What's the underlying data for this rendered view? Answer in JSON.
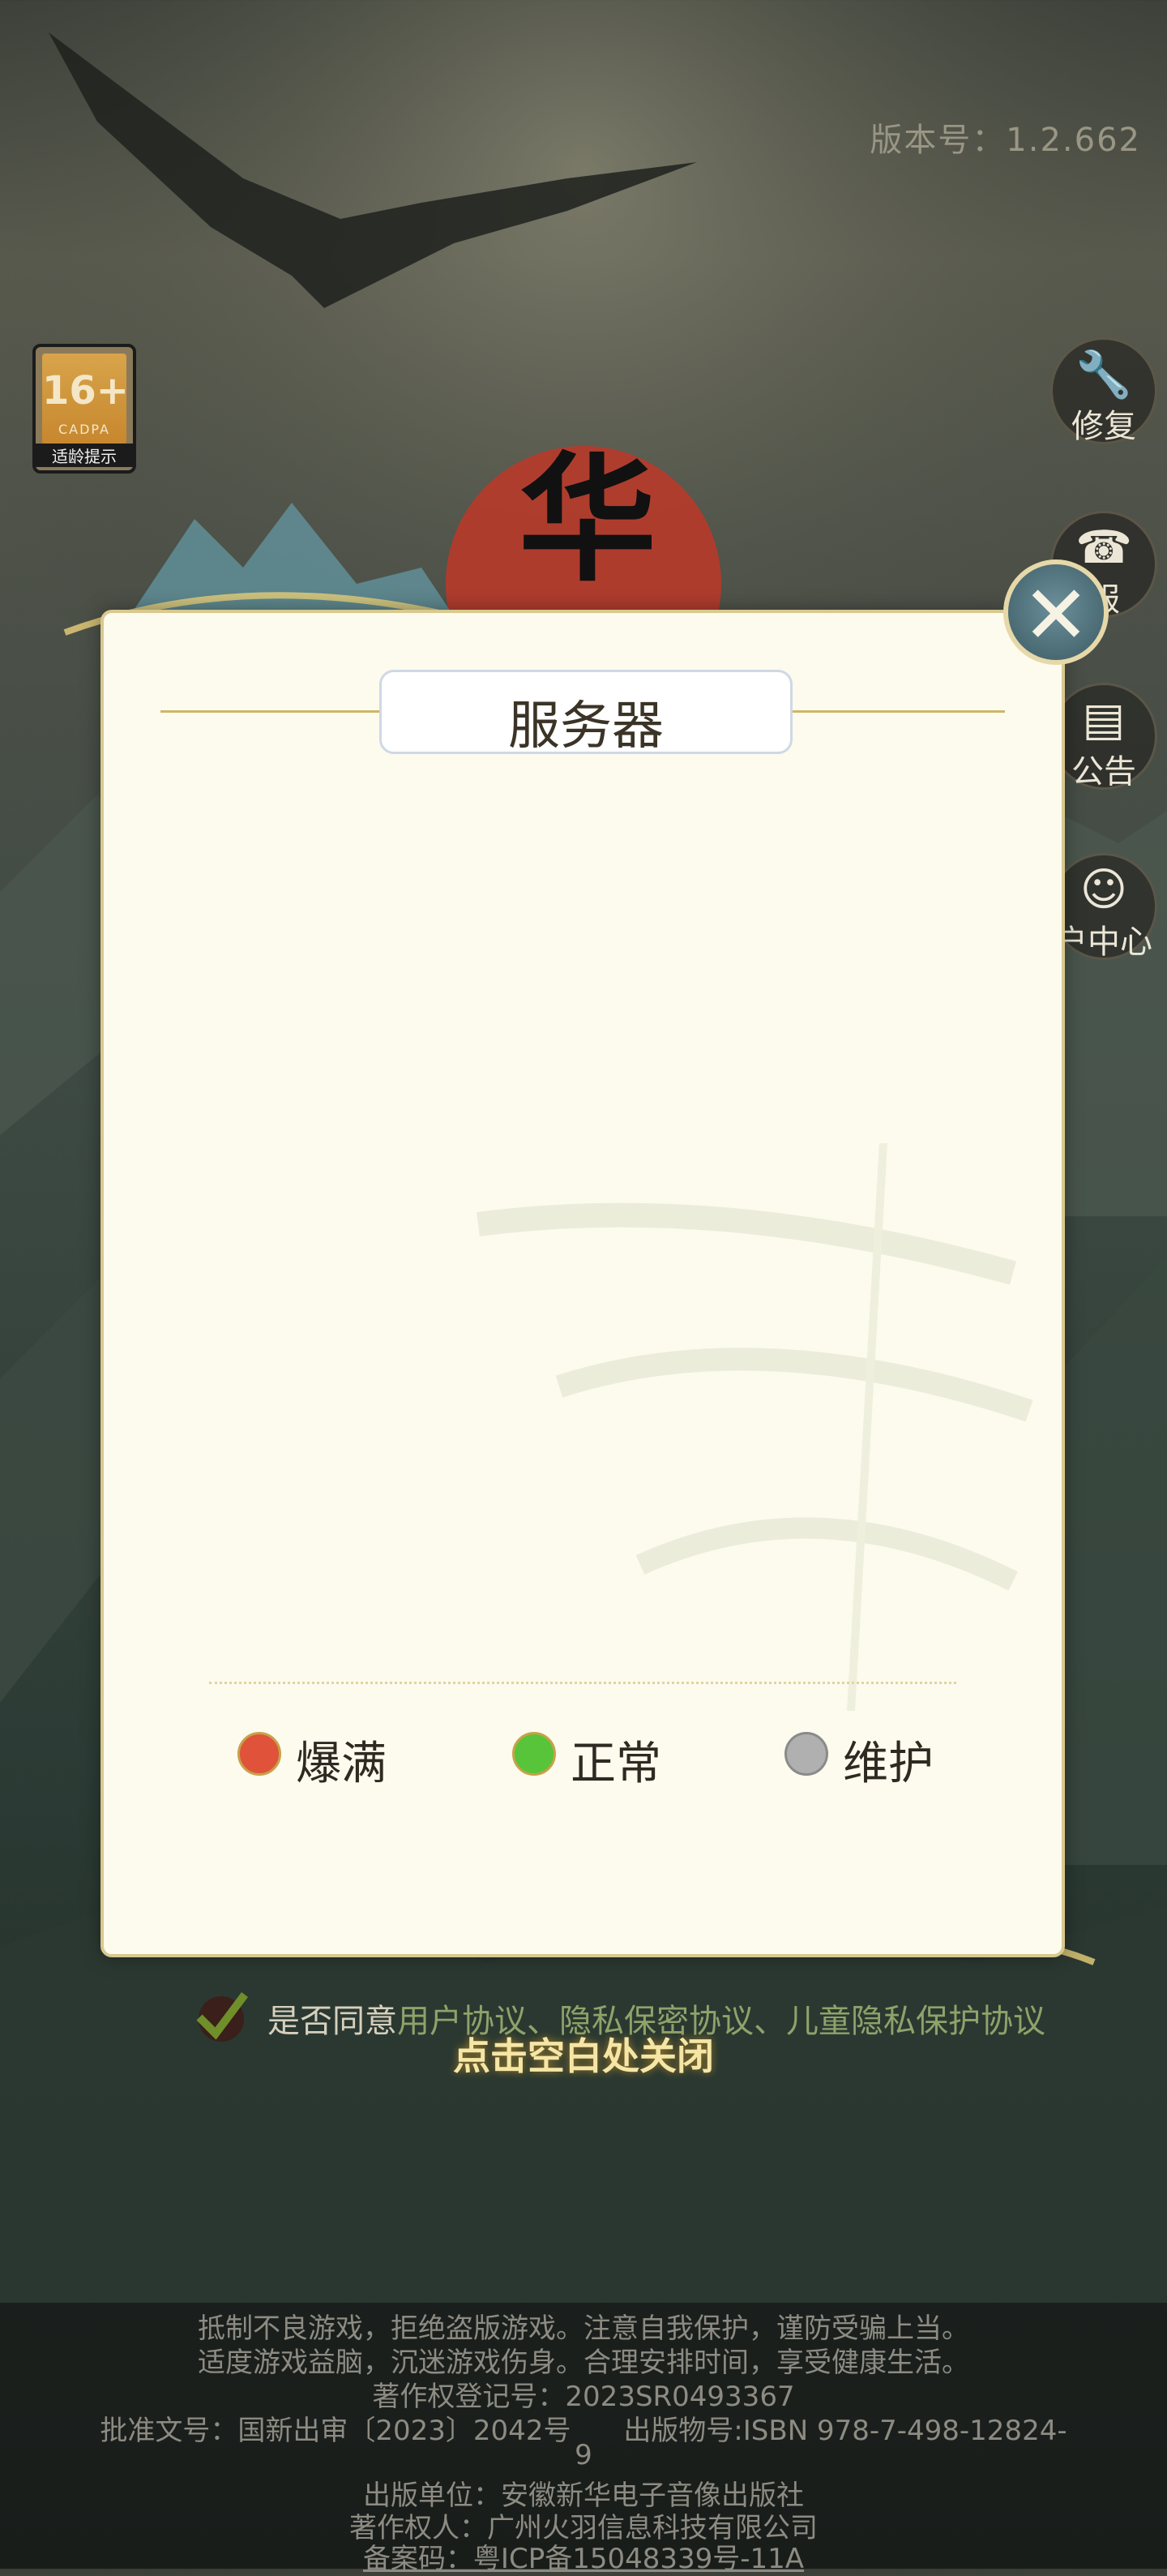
{
  "version_text": "版本号：1.2.662",
  "age_rating": {
    "number": "16+",
    "org": "CADPA",
    "tip": "适龄提示"
  },
  "side_buttons": [
    {
      "label": "修复"
    },
    {
      "label": "服"
    },
    {
      "label": "公告"
    },
    {
      "label": "户中心"
    }
  ],
  "modal": {
    "title": "服务器",
    "legend": [
      {
        "label": "爆满",
        "color": "#e0523a"
      },
      {
        "label": "正常",
        "color": "#58c43a"
      },
      {
        "label": "维护",
        "color": "#b0b0b0"
      }
    ]
  },
  "agreement": {
    "prefix": "是否同意",
    "user_agreement": "用户协议",
    "privacy_agreement": "隐私保密协议",
    "child_privacy": "儿童隐私保护协议"
  },
  "close_hint": "点击空白处关闭",
  "footer": {
    "line1": "抵制不良游戏，拒绝盗版游戏。注意自我保护，谨防受骗上当。",
    "line2": "适度游戏益脑，沉迷游戏伤身。合理安排时间，享受健康生活。",
    "line3": "著作权登记号：2023SR0493367",
    "approval": "批准文号：国新出审〔2023〕2042号",
    "isbn": "出版物号:ISBN 978-7-498-12824-",
    "isbn_tail": "9",
    "publisher": "出版单位：安徽新华电子音像出版社",
    "copyright_owner": "著作权人：广州火羽信息科技有限公司",
    "icp": "备案码：粤ICP备15048339号-11A"
  }
}
